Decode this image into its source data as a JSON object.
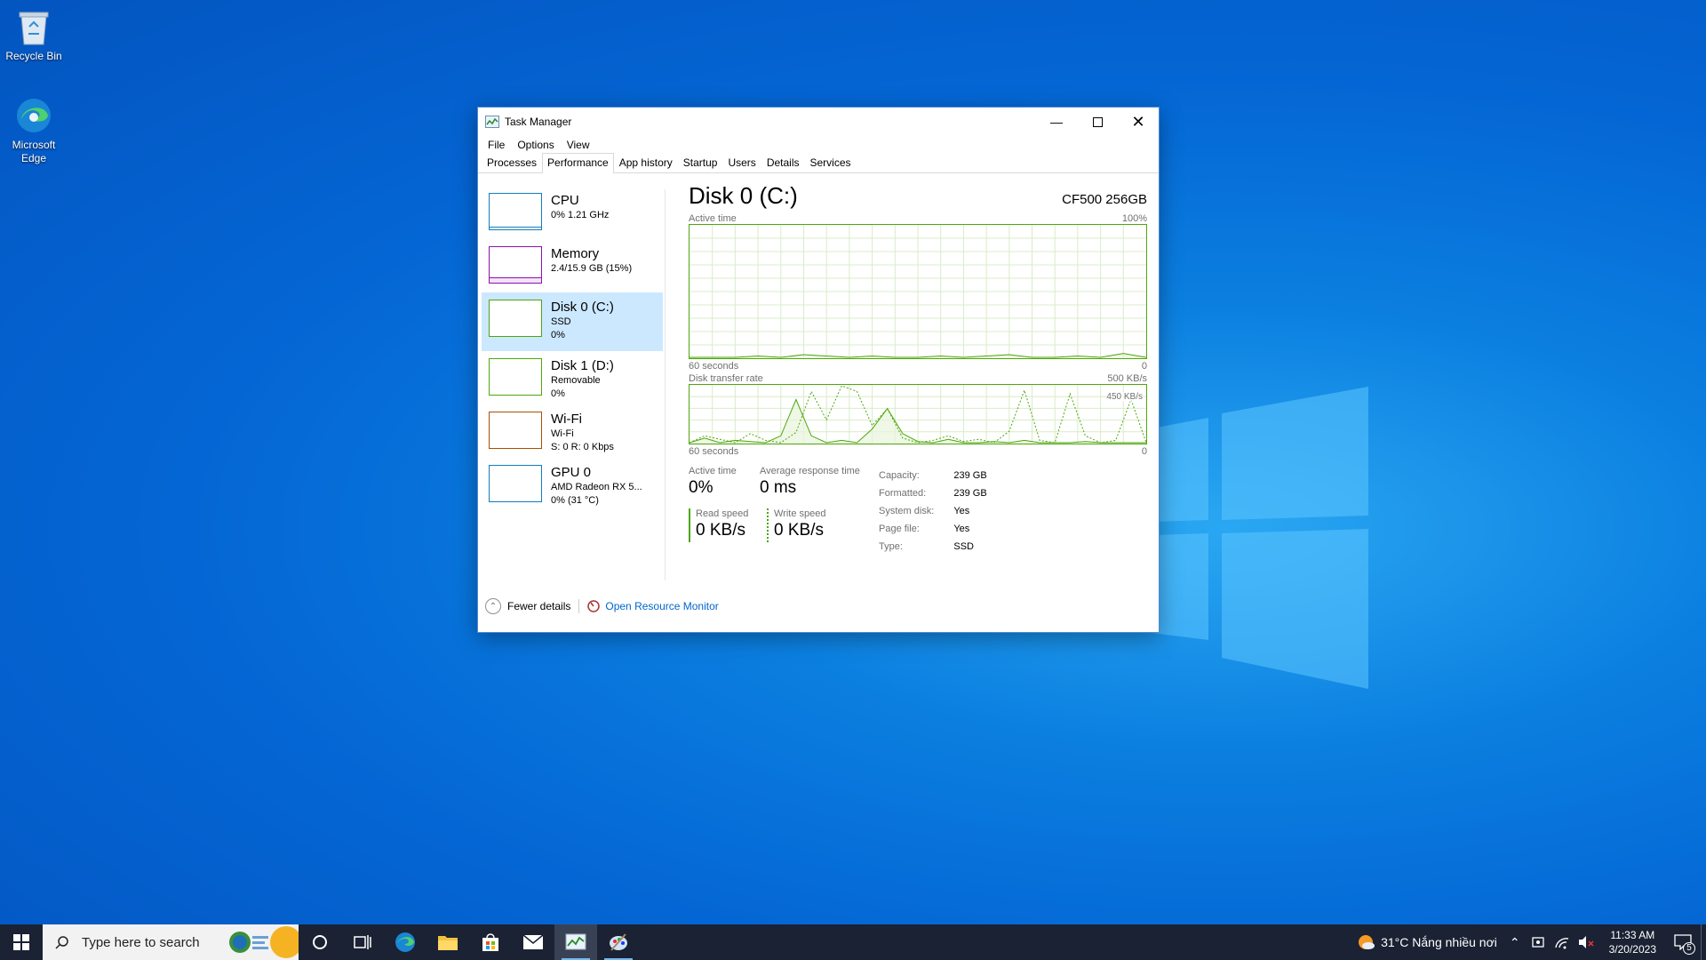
{
  "desktop": {
    "icons": [
      {
        "label": "Recycle Bin",
        "icon": "recycle-bin-icon"
      },
      {
        "label": "Microsoft Edge",
        "icon": "edge-icon"
      }
    ]
  },
  "window": {
    "title": "Task Manager",
    "menu": [
      "File",
      "Options",
      "View"
    ],
    "tabs": [
      "Processes",
      "Performance",
      "App history",
      "Startup",
      "Users",
      "Details",
      "Services"
    ],
    "active_tab": "Performance"
  },
  "sidebar": {
    "items": [
      {
        "name": "CPU",
        "line1": "0%  1.21 GHz",
        "line2": "",
        "color": "#117dbb"
      },
      {
        "name": "Memory",
        "line1": "2.4/15.9 GB (15%)",
        "line2": "",
        "color": "#8b12ae"
      },
      {
        "name": "Disk 0 (C:)",
        "line1": "SSD",
        "line2": "0%",
        "color": "#4da60c",
        "selected": true
      },
      {
        "name": "Disk 1 (D:)",
        "line1": "Removable",
        "line2": "0%",
        "color": "#4da60c"
      },
      {
        "name": "Wi-Fi",
        "line1": "Wi-Fi",
        "line2": "S: 0  R: 0 Kbps",
        "color": "#a74f01"
      },
      {
        "name": "GPU 0",
        "line1": "AMD Radeon RX 5...",
        "line2": "0%  (31 °C)",
        "color": "#117dbb"
      }
    ]
  },
  "detail": {
    "title": "Disk 0 (C:)",
    "model": "CF500 256GB",
    "active_graph": {
      "label": "Active time",
      "max": "100%",
      "x_left": "60 seconds",
      "x_right": "0"
    },
    "transfer_graph": {
      "label": "Disk transfer rate",
      "max": "500 KB/s",
      "marker": "450 KB/s",
      "x_left": "60 seconds",
      "x_right": "0"
    },
    "stats": {
      "active_time_label": "Active time",
      "active_time_value": "0%",
      "response_label": "Average response time",
      "response_value": "0 ms",
      "read_label": "Read speed",
      "read_value": "0 KB/s",
      "write_label": "Write speed",
      "write_value": "0 KB/s"
    },
    "properties": [
      {
        "key": "Capacity:",
        "value": "239 GB"
      },
      {
        "key": "Formatted:",
        "value": "239 GB"
      },
      {
        "key": "System disk:",
        "value": "Yes"
      },
      {
        "key": "Page file:",
        "value": "Yes"
      },
      {
        "key": "Type:",
        "value": "SSD"
      }
    ]
  },
  "footer": {
    "fewer_details": "Fewer details",
    "resource_monitor": "Open Resource Monitor"
  },
  "taskbar": {
    "search_placeholder": "Type here to search",
    "weather": "31°C  Nắng nhiều nơi",
    "time": "11:33 AM",
    "date": "3/20/2023",
    "notification_count": "5"
  },
  "chart_data": [
    {
      "type": "line",
      "title": "Active time",
      "ylim": [
        0,
        100
      ],
      "x": [
        60,
        57,
        54,
        51,
        48,
        45,
        42,
        39,
        36,
        33,
        30,
        27,
        24,
        21,
        18,
        15,
        12,
        9,
        6,
        3,
        0
      ],
      "series": [
        {
          "values": [
            0,
            0,
            0,
            1,
            0,
            2,
            1,
            0,
            1,
            0,
            0,
            1,
            0,
            1,
            2,
            0,
            0,
            1,
            0,
            3,
            0
          ]
        }
      ]
    },
    {
      "type": "line",
      "title": "Disk transfer rate",
      "ylim": [
        0,
        500
      ],
      "x": [
        60,
        58,
        56,
        54,
        52,
        50,
        48,
        46,
        44,
        42,
        40,
        38,
        36,
        34,
        32,
        30,
        28,
        26,
        24,
        22,
        20,
        18,
        16,
        14,
        12,
        10,
        8,
        6,
        4,
        2,
        0
      ],
      "series": [
        {
          "values": [
            0,
            40,
            0,
            20,
            10,
            0,
            60,
            380,
            60,
            0,
            20,
            0,
            120,
            300,
            80,
            10,
            0,
            30,
            0,
            0,
            10,
            0,
            20,
            0,
            0,
            0,
            10,
            0,
            0,
            0,
            0
          ]
        },
        {
          "values": [
            0,
            60,
            30,
            0,
            80,
            20,
            0,
            90,
            450,
            200,
            500,
            450,
            150,
            300,
            40,
            0,
            20,
            60,
            10,
            30,
            0,
            100,
            460,
            20,
            0,
            430,
            60,
            0,
            20,
            380,
            0
          ]
        }
      ]
    }
  ]
}
